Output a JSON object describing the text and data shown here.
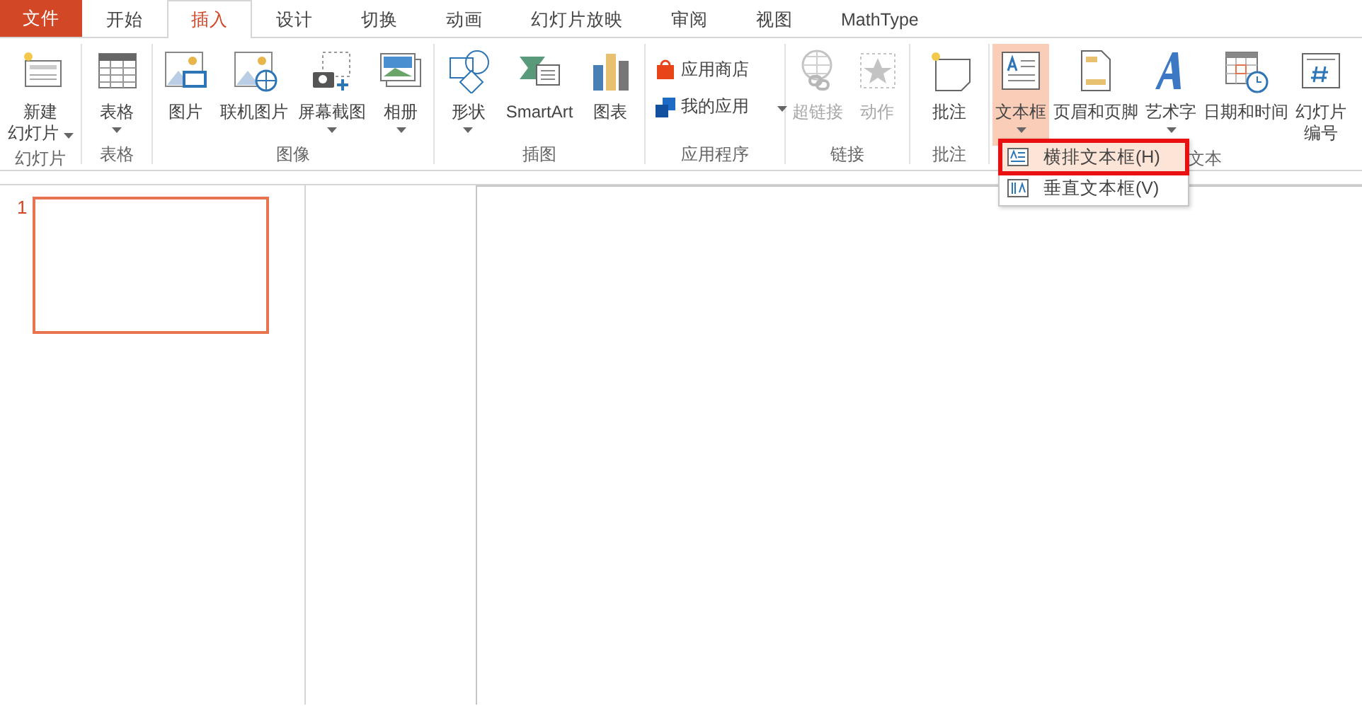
{
  "tabs": [
    {
      "label": "文件",
      "kind": "file",
      "selected": false
    },
    {
      "label": "开始",
      "kind": "tab",
      "selected": false
    },
    {
      "label": "插入",
      "kind": "tab",
      "selected": true
    },
    {
      "label": "设计",
      "kind": "tab",
      "selected": false
    },
    {
      "label": "切换",
      "kind": "tab",
      "selected": false
    },
    {
      "label": "动画",
      "kind": "tab",
      "selected": false
    },
    {
      "label": "幻灯片放映",
      "kind": "tab",
      "selected": false
    },
    {
      "label": "审阅",
      "kind": "tab",
      "selected": false
    },
    {
      "label": "视图",
      "kind": "tab",
      "selected": false
    },
    {
      "label": "MathType",
      "kind": "tab",
      "selected": false
    }
  ],
  "ribbon": {
    "groups": [
      {
        "label": "幻灯片",
        "buttons": [
          {
            "kind": "large",
            "lines": [
              "新建",
              "幻灯片"
            ],
            "dropdown": true,
            "disabled": false,
            "selected": false
          }
        ]
      },
      {
        "label": "表格",
        "buttons": [
          {
            "kind": "large",
            "lines": [
              "表格"
            ],
            "dropdown": true,
            "disabled": false,
            "selected": false
          }
        ]
      },
      {
        "label": "图像",
        "buttons": [
          {
            "kind": "large",
            "lines": [
              "图片"
            ],
            "disabled": false,
            "selected": false
          },
          {
            "kind": "large",
            "lines": [
              "联机图片"
            ],
            "disabled": false,
            "selected": false
          },
          {
            "kind": "large",
            "lines": [
              "屏幕截图"
            ],
            "dropdown": true,
            "disabled": false,
            "selected": false
          },
          {
            "kind": "large",
            "lines": [
              "相册"
            ],
            "dropdown": true,
            "disabled": false,
            "selected": false
          }
        ]
      },
      {
        "label": "插图",
        "buttons": [
          {
            "kind": "large",
            "lines": [
              "形状"
            ],
            "dropdown": true,
            "disabled": false,
            "selected": false
          },
          {
            "kind": "large",
            "lines": [
              "SmartArt"
            ],
            "disabled": false,
            "selected": false
          },
          {
            "kind": "large",
            "lines": [
              "图表"
            ],
            "disabled": false,
            "selected": false
          }
        ]
      },
      {
        "label": "应用程序",
        "buttons": [
          {
            "kind": "small",
            "lines": [
              "应用商店"
            ],
            "disabled": false,
            "selected": false
          },
          {
            "kind": "small",
            "lines": [
              "我的应用"
            ],
            "dropdown": true,
            "disabled": false,
            "selected": false
          }
        ]
      },
      {
        "label": "链接",
        "buttons": [
          {
            "kind": "large",
            "lines": [
              "超链接"
            ],
            "disabled": true,
            "selected": false
          },
          {
            "kind": "large",
            "lines": [
              "动作"
            ],
            "disabled": true,
            "selected": false
          }
        ]
      },
      {
        "label": "批注",
        "buttons": [
          {
            "kind": "large",
            "lines": [
              "批注"
            ],
            "disabled": false,
            "selected": false
          }
        ]
      },
      {
        "label": "文本",
        "buttons": [
          {
            "kind": "large",
            "lines": [
              "文本框"
            ],
            "dropdown": true,
            "disabled": false,
            "selected": true
          },
          {
            "kind": "large",
            "lines": [
              "页眉和页脚"
            ],
            "disabled": false,
            "selected": false
          },
          {
            "kind": "large",
            "lines": [
              "艺术字"
            ],
            "dropdown": true,
            "disabled": false,
            "selected": false
          },
          {
            "kind": "large",
            "lines": [
              "日期和时间"
            ],
            "disabled": false,
            "selected": false
          },
          {
            "kind": "large",
            "lines": [
              "幻灯片",
              "编号"
            ],
            "disabled": false,
            "selected": false
          }
        ]
      }
    ]
  },
  "dropdown_menu": {
    "items": [
      {
        "label": "横排文本框(H)",
        "selected": true
      },
      {
        "label": "垂直文本框(V)",
        "selected": false
      }
    ]
  },
  "slides_panel": {
    "slides": [
      {
        "number": "1",
        "selected": true
      }
    ]
  }
}
